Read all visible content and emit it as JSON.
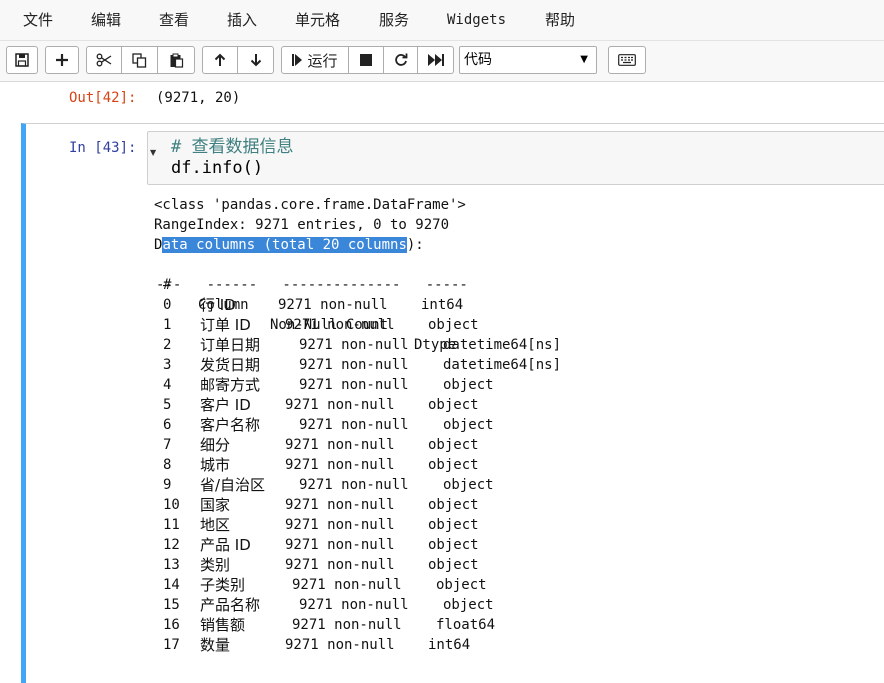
{
  "menu": [
    "文件",
    "编辑",
    "查看",
    "插入",
    "单元格",
    "服务",
    "Widgets",
    "帮助"
  ],
  "toolbar": {
    "run_label": "运行",
    "cell_type": "代码"
  },
  "prev_cell": {
    "out_prompt": "Out[42]:",
    "output": "(9271, 20)"
  },
  "cell": {
    "in_prompt": "In [43]:",
    "code": [
      "# 查看数据信息",
      "df.info()"
    ],
    "output": {
      "class_line": "<class 'pandas.core.frame.DataFrame'>",
      "range_index": "RangeIndex: 9271 entries, 0 to 9270",
      "data_cols_before": "D",
      "data_cols_highlight": "ata columns (total 20 columns",
      "data_cols_after": "):",
      "header": {
        "idx": "#",
        "column": "Column",
        "non_null": "Non-Null Count",
        "dtype": "Dtype"
      },
      "separator": "---   ------   --------------   -----",
      "rows": [
        {
          "idx": "0",
          "column": "行 ID",
          "non_null": "9271 non-null",
          "dtype": "int64"
        },
        {
          "idx": "1",
          "column": "订单 ID",
          "non_null": "9271 non-null",
          "dtype": "object"
        },
        {
          "idx": "2",
          "column": "订单日期",
          "non_null": "9271 non-null",
          "dtype": "datetime64[ns]"
        },
        {
          "idx": "3",
          "column": "发货日期",
          "non_null": "9271 non-null",
          "dtype": "datetime64[ns]"
        },
        {
          "idx": "4",
          "column": "邮寄方式",
          "non_null": "9271 non-null",
          "dtype": "object"
        },
        {
          "idx": "5",
          "column": "客户 ID",
          "non_null": "9271 non-null",
          "dtype": "object"
        },
        {
          "idx": "6",
          "column": "客户名称",
          "non_null": "9271 non-null",
          "dtype": "object"
        },
        {
          "idx": "7",
          "column": "细分",
          "non_null": "9271 non-null",
          "dtype": "object"
        },
        {
          "idx": "8",
          "column": "城市",
          "non_null": "9271 non-null",
          "dtype": "object"
        },
        {
          "idx": "9",
          "column": "省/自治区",
          "non_null": "9271 non-null",
          "dtype": "object"
        },
        {
          "idx": "10",
          "column": "国家",
          "non_null": "9271 non-null",
          "dtype": "object"
        },
        {
          "idx": "11",
          "column": "地区",
          "non_null": "9271 non-null",
          "dtype": "object"
        },
        {
          "idx": "12",
          "column": "产品 ID",
          "non_null": "9271 non-null",
          "dtype": "object"
        },
        {
          "idx": "13",
          "column": "类别",
          "non_null": "9271 non-null",
          "dtype": "object"
        },
        {
          "idx": "14",
          "column": "子类别",
          "non_null": "9271 non-null",
          "dtype": "object"
        },
        {
          "idx": "15",
          "column": "产品名称",
          "non_null": "9271 non-null",
          "dtype": "object"
        },
        {
          "idx": "16",
          "column": "销售额",
          "non_null": "9271 non-null",
          "dtype": "float64"
        },
        {
          "idx": "17",
          "column": "数量",
          "non_null": "9271 non-null",
          "dtype": "int64"
        }
      ]
    }
  }
}
